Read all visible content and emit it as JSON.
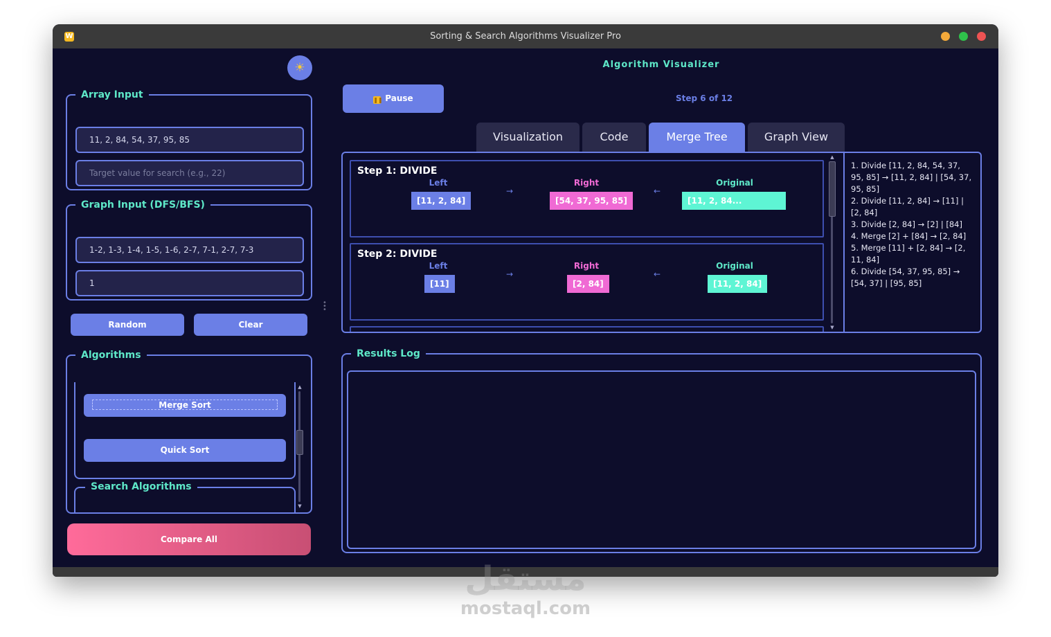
{
  "window": {
    "title": "Sorting & Search Algorithms Visualizer Pro",
    "app_icon": "W"
  },
  "sidebar": {
    "theme_icon": "☀",
    "array_input": {
      "legend": "Array Input",
      "array_value": "11, 2, 84, 54, 37, 95, 85",
      "target_placeholder": "Target value for search (e.g., 22)"
    },
    "graph_input": {
      "legend": "Graph Input (DFS/BFS)",
      "edges_value": "1-2, 1-3, 1-4, 1-5, 1-6, 2-7, 7-1, 2-7, 7-3",
      "start_value": "1"
    },
    "random_label": "Random",
    "clear_label": "Clear",
    "algorithms": {
      "legend": "Algorithms",
      "items": [
        {
          "label": "Merge Sort"
        },
        {
          "label": "Quick Sort"
        }
      ],
      "search_legend": "Search Algorithms"
    },
    "compare_label": "Compare All"
  },
  "main": {
    "title": "Algorithm Visualizer",
    "pause_label": "Pause",
    "step_text": "Step 6 of 12",
    "tabs": [
      {
        "label": "Visualization"
      },
      {
        "label": "Code"
      },
      {
        "label": "Merge Tree",
        "active": true
      },
      {
        "label": "Graph View"
      }
    ],
    "merge_tree": {
      "steps": [
        {
          "title": "Step 1: DIVIDE",
          "left_label": "Left",
          "right_label": "Right",
          "original_label": "Original",
          "left": "[11, 2, 84]",
          "right": "[54, 37, 95, 85]",
          "original": "[11, 2, 84..."
        },
        {
          "title": "Step 2: DIVIDE",
          "left_label": "Left",
          "right_label": "Right",
          "original_label": "Original",
          "left": "[11]",
          "right": "[2, 84]",
          "original": "[11, 2, 84]"
        }
      ],
      "arrow_right": "→",
      "arrow_left": "←",
      "description": [
        "1. Divide [11, 2, 84, 54, 37, 95, 85] → [11, 2, 84] | [54, 37, 95, 85]",
        "2. Divide [11, 2, 84] → [11] | [2, 84]",
        "3. Divide [2, 84] → [2] | [84]",
        "4. Merge [2] + [84] → [2, 84]",
        "5. Merge [11] + [2, 84] → [2, 11, 84]",
        "6. Divide [54, 37, 95, 85] → [54, 37] | [95, 85]"
      ]
    },
    "results_legend": "Results Log"
  },
  "colors": {
    "background": "#0d0d2b",
    "accent": "#6b7fe6",
    "heading": "#5ee8c8",
    "pink": "#f06ad4",
    "teal": "#5ef5d4"
  },
  "watermark": {
    "arabic": "مستقل",
    "latin": "mostaql.com"
  }
}
